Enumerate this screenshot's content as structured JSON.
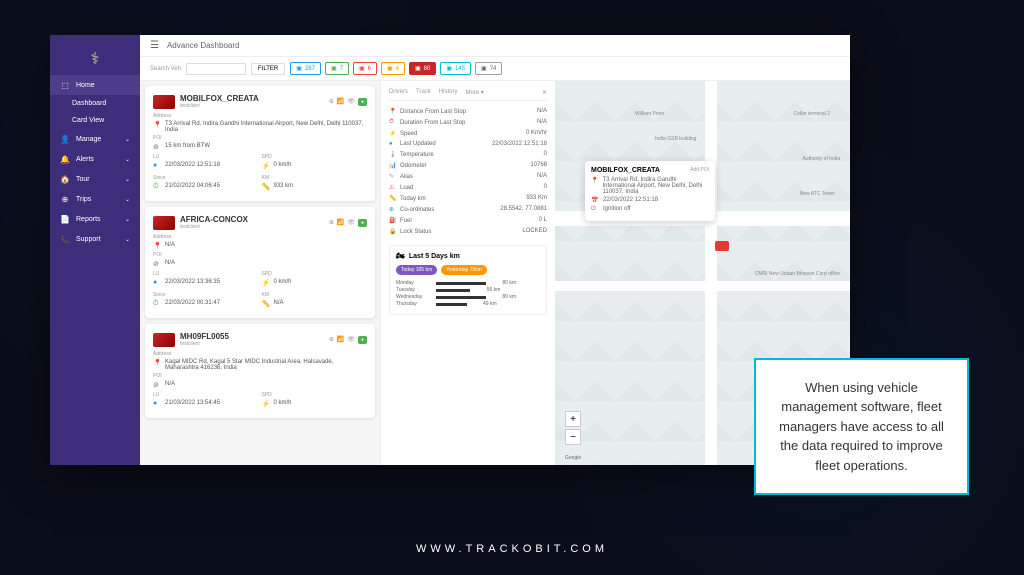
{
  "header": {
    "title": "Advance Dashboard"
  },
  "search": {
    "label": "Search Veh",
    "filter": "FILTER"
  },
  "stats": [
    {
      "value": "287",
      "cls": "blue"
    },
    {
      "value": "7",
      "cls": "green"
    },
    {
      "value": "6",
      "cls": "red"
    },
    {
      "value": "4",
      "cls": "orange"
    },
    {
      "value": "80",
      "cls": "darkred"
    },
    {
      "value": "145",
      "cls": "cyan"
    },
    {
      "value": "74",
      "cls": "gray"
    }
  ],
  "sidebar": {
    "items": [
      {
        "icon": "⬚",
        "label": "Home",
        "active": true,
        "expandable": false
      },
      {
        "icon": "",
        "label": "Dashboard",
        "sub": true
      },
      {
        "icon": "",
        "label": "Card View",
        "sub": true
      },
      {
        "icon": "👤",
        "label": "Manage",
        "expandable": true
      },
      {
        "icon": "🔔",
        "label": "Alerts",
        "expandable": true
      },
      {
        "icon": "🏠",
        "label": "Tour",
        "expandable": true
      },
      {
        "icon": "⊕",
        "label": "Trips",
        "expandable": true
      },
      {
        "icon": "📄",
        "label": "Reports",
        "expandable": true
      },
      {
        "icon": "📞",
        "label": "Support",
        "expandable": true
      }
    ]
  },
  "vehicles": [
    {
      "name": "MOBILFOX_CREATA",
      "sub": "testclient",
      "badge": "●",
      "address_label": "Address",
      "address": "T3 Arrival Rd, Indira Gandhi International Airport, New Delhi, Delhi 110037, India",
      "poi_label": "POI",
      "poi": "15 km from BTW",
      "lu_label": "LU",
      "lu": "22/03/2022 12:51:18",
      "since_label": "Since",
      "since": "21/02/2022 04:06:45",
      "spd_label": "SPD",
      "spd": "0 km/h",
      "km_label": "KM",
      "km": "933 km"
    },
    {
      "name": "AFRICA-CONCOX",
      "sub": "testclient",
      "address_label": "Address",
      "address": "N/A",
      "poi_label": "POI",
      "poi": "N/A",
      "lu_label": "LU",
      "lu": "22/03/2022 13:36:35",
      "since_label": "Since",
      "since": "22/03/2022 00:31:47",
      "spd_label": "SPD",
      "spd": "0 km/h",
      "km_label": "KM",
      "km": "N/A"
    },
    {
      "name": "MH09FL0055",
      "sub": "testclient",
      "address_label": "Address",
      "address": "Kagal MIDC Rd, Kagal 5 Star MIDC Industrial Area, Halsavade, Maharashtra 416236, India",
      "poi_label": "POI",
      "poi": "N/A",
      "lu_label": "LU",
      "lu": "21/03/2022 13:54:45",
      "spd_label": "SPD",
      "spd": "0 km/h"
    }
  ],
  "detail": {
    "tabs": [
      "Drivers",
      "Track",
      "History",
      "More ▾"
    ],
    "rows": [
      {
        "icon": "📍",
        "label": "Distance From Last Stop",
        "value": "N/A",
        "color": "#e91e63"
      },
      {
        "icon": "⏱",
        "label": "Duration From Last Stop",
        "value": "N/A",
        "color": "#e91e63"
      },
      {
        "icon": "⚡",
        "label": "Speed",
        "value": "0 Km/hr",
        "color": "#4caf50"
      },
      {
        "icon": "●",
        "label": "Last Updated",
        "value": "22/03/2022 12:51:18",
        "color": "#2196f3"
      },
      {
        "icon": "🌡",
        "label": "Temperature",
        "value": "0",
        "color": "#999"
      },
      {
        "icon": "📊",
        "label": "Odometer",
        "value": "10768",
        "color": "#ff9800"
      },
      {
        "icon": "✎",
        "label": "Alias",
        "value": "N/A",
        "color": "#999"
      },
      {
        "icon": "⚠",
        "label": "Load",
        "value": "0",
        "color": "#f44336"
      },
      {
        "icon": "📏",
        "label": "Today km",
        "value": "933 Km",
        "color": "#e91e63"
      },
      {
        "icon": "⊕",
        "label": "Co-ordinates",
        "value": "28.5542, 77.0881",
        "color": "#2196f3"
      },
      {
        "icon": "⛽",
        "label": "Fuel",
        "value": "0 L",
        "color": "#999"
      },
      {
        "icon": "🔒",
        "label": "Lock Status",
        "value": "LOCKED",
        "color": "#666"
      }
    ]
  },
  "chart_data": {
    "type": "bar",
    "title": "Last 5 Days km",
    "pills": [
      {
        "label": "Today 105 km",
        "cls": "purple"
      },
      {
        "label": "Yesterday 75km",
        "cls": "orange"
      }
    ],
    "categories": [
      "Monday",
      "Tuesday",
      "Wednesday",
      "Thursday"
    ],
    "values": [
      80,
      55,
      80,
      49
    ],
    "unit": "km"
  },
  "map": {
    "popup": {
      "title": "MOBILFOX_CREATA",
      "add_poi": "Add POI",
      "address": "T3 Arrival Rd, Indira Gandhi International Airport, New Delhi, Delhi 110037, India",
      "date": "22/03/2022 12:51:18",
      "status": "Ignition off"
    },
    "labels": [
      "William Penn",
      "Cellar terminal 2",
      "India GSB building",
      "Authority of India",
      "New ATC Tower",
      "CMRI New Udaan Bhawan Corp office"
    ],
    "google": "Google"
  },
  "callout": "When using vehicle management software, fleet managers have access to all the data required to improve fleet operations.",
  "footer": "WWW.TRACKOBIT.COM"
}
